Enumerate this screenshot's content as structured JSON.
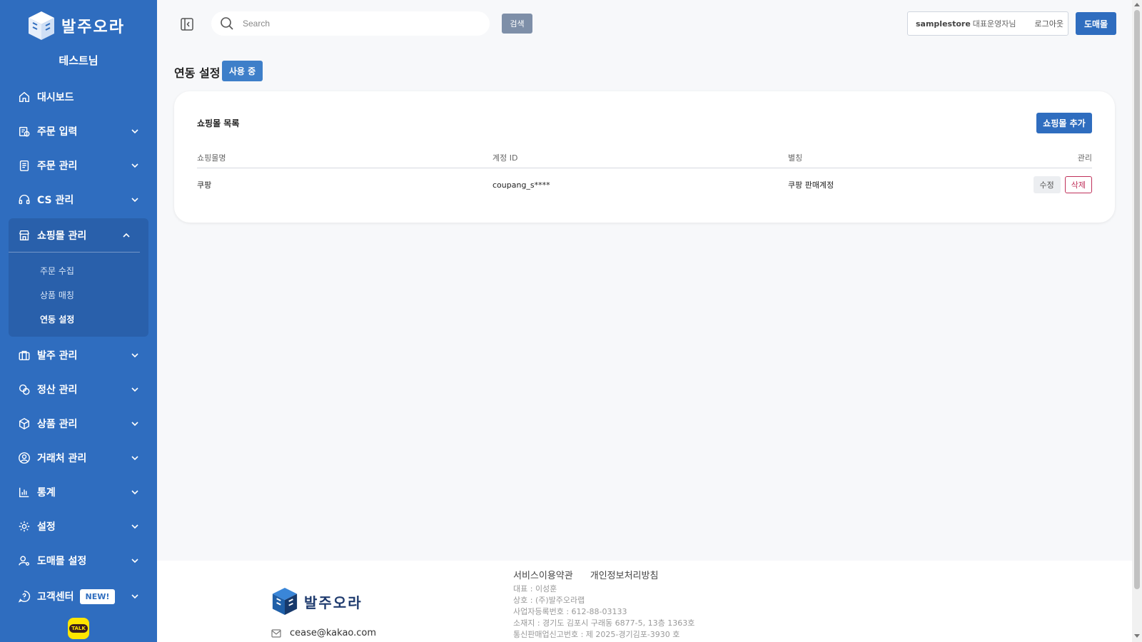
{
  "brand": {
    "logo_text": "발주오라",
    "primary_color": "#2f6dbf"
  },
  "sidebar": {
    "store_name": "테스트님",
    "items": [
      {
        "label": "대시보드",
        "icon": "home-icon"
      },
      {
        "label": "주문 입력",
        "icon": "order-input-icon"
      },
      {
        "label": "주문 관리",
        "icon": "clipboard-icon"
      },
      {
        "label": "CS 관리",
        "icon": "headset-icon"
      },
      {
        "label": "쇼핑몰 관리",
        "icon": "store-icon",
        "expanded": true,
        "children": [
          {
            "label": "주문 수집"
          },
          {
            "label": "상품 매칭"
          },
          {
            "label": "연동 설정",
            "active": true
          }
        ]
      },
      {
        "label": "발주 관리",
        "icon": "briefcase-icon"
      },
      {
        "label": "정산 관리",
        "icon": "coins-icon"
      },
      {
        "label": "상품 관리",
        "icon": "package-icon"
      },
      {
        "label": "거래처 관리",
        "icon": "user-circle-icon"
      },
      {
        "label": "통계",
        "icon": "bar-chart-icon"
      },
      {
        "label": "설정",
        "icon": "gear-icon"
      },
      {
        "label": "도매몰 설정",
        "icon": "user-settings-icon"
      },
      {
        "label": "고객센터",
        "icon": "help-icon",
        "badge": "NEW!"
      }
    ],
    "kakao_talk": "TALK"
  },
  "topbar": {
    "search_placeholder": "Search",
    "search_button": "검색",
    "user_id": "samplestore",
    "user_role": "대표운영자님",
    "logout": "로그아웃",
    "wholesale_button": "도매몰"
  },
  "page": {
    "title": "연동 설정",
    "status_badge": "사용 중"
  },
  "card": {
    "title": "쇼핑몰 목록",
    "add_button": "쇼핑몰 추가",
    "columns": [
      "쇼핑몰명",
      "계정 ID",
      "별칭",
      "관리"
    ],
    "rows": [
      {
        "mall": "쿠팡",
        "account_id": "coupang_s****",
        "alias": "쿠팡 판매계정",
        "edit": "수정",
        "delete": "삭제"
      }
    ]
  },
  "footer": {
    "logo_text": "발주오라",
    "email": "cease@kakao.com",
    "links": [
      "서비스이용약관",
      "개인정보처리방침"
    ],
    "info": [
      "대표 : 이성훈",
      "상호 : (주)발주오라랩",
      "사업자등록번호 : 612-88-03133",
      "소재지 : 경기도 김포시 구래동 6877-5, 13층 1363호",
      "통신판매업신고번호 : 제 2025-경기김포-3930 호"
    ]
  }
}
